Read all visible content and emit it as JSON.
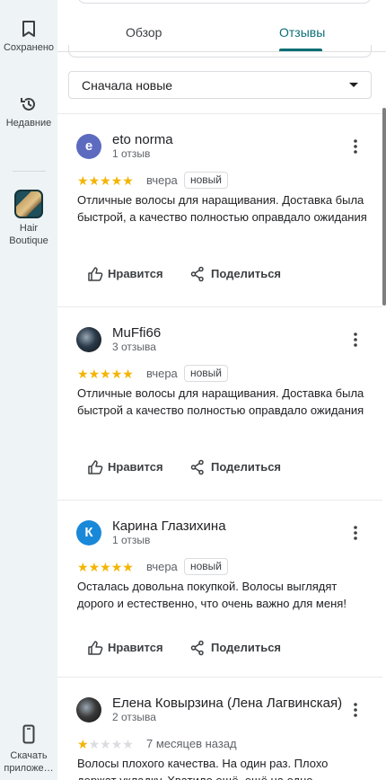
{
  "rail": {
    "saved_label": "Сохранено",
    "recent_label": "Недавние",
    "place_label": "Hair Boutique",
    "download_label": "Скачать приложе…"
  },
  "tabs": [
    {
      "label": "Обзор",
      "active": false
    },
    {
      "label": "Отзывы",
      "active": true
    }
  ],
  "sort": {
    "label": "Сначала новые"
  },
  "actions": {
    "like": "Нравится",
    "share": "Поделиться"
  },
  "reviews": [
    {
      "author": "eto norma",
      "avatar_letter": "e",
      "avatar_color": "#5c6bc0",
      "count": "1 отзыв",
      "rating": 5,
      "date": "вчера",
      "badge": "новый",
      "text": "Отличные волосы для наращивания. Доставка была быстрой, а качество полностью оправдало ожидания"
    },
    {
      "author": "MuFfi66",
      "avatar_letter": "",
      "avatar_color": "#2a3a4a",
      "count": "3 отзыва",
      "rating": 5,
      "date": "вчера",
      "badge": "новый",
      "text": "Отличные волосы для наращивания. Доставка была быстрой а качество полностью оправдало ожидания"
    },
    {
      "author": "Карина Глазихина",
      "avatar_letter": "К",
      "avatar_color": "#1a88d8",
      "count": "1 отзыв",
      "rating": 5,
      "date": "вчера",
      "badge": "новый",
      "text": "Осталась довольна покупкой. Волосы выглядят дорого и естественно, что очень важно для меня!"
    },
    {
      "author": "Елена Ковырзина (Лена Лагвинская)",
      "avatar_letter": "",
      "avatar_color": "#3a3a3a",
      "count": "2 отзыва",
      "rating": 1,
      "date": "7 месяцев назад",
      "badge": "",
      "text": "Волосы плохого качества. На один раз. Плохо держат укладку. Хватило ещё, ещё на одно"
    }
  ]
}
